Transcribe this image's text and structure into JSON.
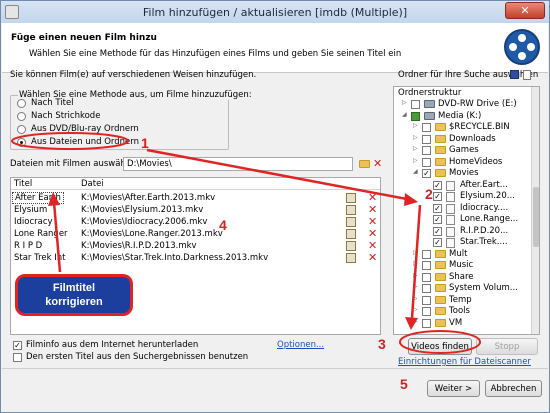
{
  "window": {
    "title": "Film hinzufügen / aktualisieren [imdb (Multiple)]",
    "close_label": "✕"
  },
  "header": {
    "heading": "Füge einen neuen Film hinzu",
    "subtext": "Wählen Sie eine Methode für das Hinzufügen eines Films und geben Sie seinen Titel ein"
  },
  "method": {
    "intro": "Sie können Film(e) auf verschiedenen Weisen hinzufügen.",
    "group_label": "Wählen Sie eine Methode aus, um Filme hinzuzufügen:",
    "options": [
      "Nach Titel",
      "Nach Strichkode",
      "Aus DVD/Blu-ray Ordnern",
      "Aus Dateien und Ordnern"
    ],
    "selected": "Aus Dateien und Ordnern"
  },
  "folder": {
    "label": "Dateien mit Filmen auswählen:",
    "value": "D:\\Movies\\"
  },
  "files": {
    "columns": [
      "Titel",
      "Datei"
    ],
    "rows": [
      {
        "title": "After Earth",
        "file": "K:\\Movies\\After.Earth.2013.mkv"
      },
      {
        "title": "Elysium",
        "file": "K:\\Movies\\Elysium.2013.mkv"
      },
      {
        "title": "Idiocracy",
        "file": "K:\\Movies\\Idiocracy.2006.mkv"
      },
      {
        "title": "Lone Ranger",
        "file": "K:\\Movies\\Lone.Ranger.2013.mkv"
      },
      {
        "title": "R I P D",
        "file": "K:\\Movies\\R.I.P.D.2013.mkv"
      },
      {
        "title": "Star Trek Int",
        "file": "K:\\Movies\\Star.Trek.Into.Darkness.2013.mkv"
      }
    ]
  },
  "options": {
    "download_info": "Filminfo aus dem Internet herunterladen",
    "use_first": "Den ersten Titel aus den Suchergebnissen benutzen",
    "options_link": "Optionen..."
  },
  "tree": {
    "label": "Ordner für Ihre Suche auswählen",
    "struct_label": "Ordnerstruktur",
    "nodes": [
      {
        "label": "DVD-RW Drive (E:)",
        "indent": 1,
        "kind": "drive",
        "check": "none"
      },
      {
        "label": "Media (K:)",
        "indent": 1,
        "kind": "drive",
        "check": "partial"
      },
      {
        "label": "$RECYCLE.BIN",
        "indent": 2,
        "kind": "folder",
        "check": "none"
      },
      {
        "label": "Downloads",
        "indent": 2,
        "kind": "folder",
        "check": "none"
      },
      {
        "label": "Games",
        "indent": 2,
        "kind": "folder",
        "check": "none"
      },
      {
        "label": "HomeVideos",
        "indent": 2,
        "kind": "folder",
        "check": "none"
      },
      {
        "label": "Movies",
        "indent": 2,
        "kind": "folder",
        "check": "checked"
      },
      {
        "label": "After.Eart...",
        "indent": 3,
        "kind": "file",
        "check": "checked"
      },
      {
        "label": "Elysium.20...",
        "indent": 3,
        "kind": "file",
        "check": "checked"
      },
      {
        "label": "Idiocracy....",
        "indent": 3,
        "kind": "file",
        "check": "checked"
      },
      {
        "label": "Lone.Range...",
        "indent": 3,
        "kind": "file",
        "check": "checked"
      },
      {
        "label": "R.I.P.D.20...",
        "indent": 3,
        "kind": "file",
        "check": "checked"
      },
      {
        "label": "Star.Trek....",
        "indent": 3,
        "kind": "file",
        "check": "checked"
      },
      {
        "label": "Mult",
        "indent": 2,
        "kind": "folder",
        "check": "none"
      },
      {
        "label": "Music",
        "indent": 2,
        "kind": "folder",
        "check": "none"
      },
      {
        "label": "Share",
        "indent": 2,
        "kind": "folder",
        "check": "none"
      },
      {
        "label": "System Volum...",
        "indent": 2,
        "kind": "folder",
        "check": "none"
      },
      {
        "label": "Temp",
        "indent": 2,
        "kind": "folder",
        "check": "none"
      },
      {
        "label": "Tools",
        "indent": 2,
        "kind": "folder",
        "check": "none"
      },
      {
        "label": "VM",
        "indent": 2,
        "kind": "folder",
        "check": "none"
      }
    ]
  },
  "buttons": {
    "find": "Videos finden",
    "stop": "Stopp",
    "scanner_link": "Einrichtungen für Dateiscanner",
    "next": "Weiter >",
    "cancel": "Abbrechen"
  },
  "annotations": {
    "callout_line1": "Filmtitel",
    "callout_line2": "korrigieren",
    "n1": "1",
    "n2": "2",
    "n3": "3",
    "n4": "4",
    "n5": "5",
    "color": "#e02424"
  }
}
